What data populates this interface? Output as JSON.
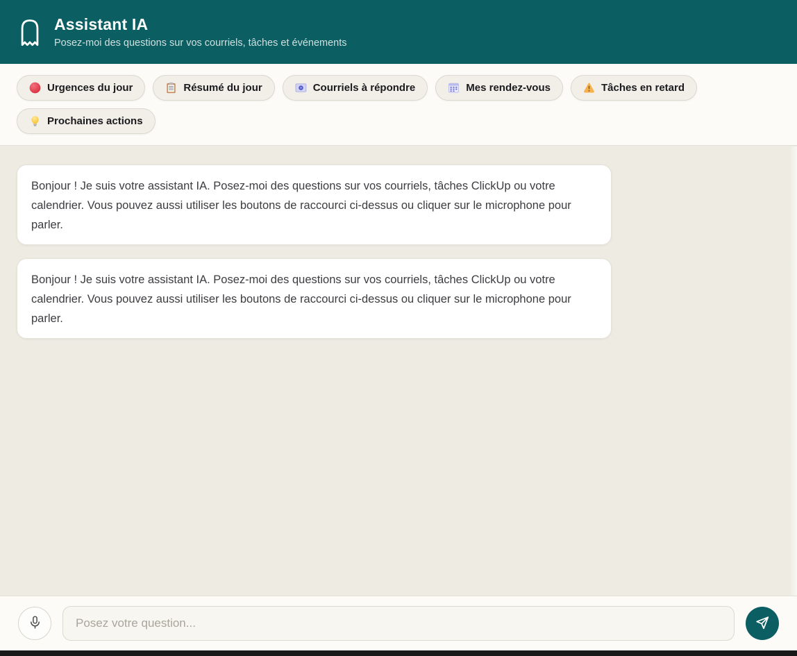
{
  "header": {
    "title": "Assistant IA",
    "subtitle": "Posez-moi des questions sur vos courriels, tâches et événements"
  },
  "quick_actions": [
    {
      "icon": "red-circle-icon",
      "label": "Urgences du jour"
    },
    {
      "icon": "clipboard-icon",
      "label": "Résumé du jour"
    },
    {
      "icon": "email-icon",
      "label": "Courriels à répondre"
    },
    {
      "icon": "calendar-icon",
      "label": "Mes rendez-vous"
    },
    {
      "icon": "warning-icon",
      "label": "Tâches en retard"
    },
    {
      "icon": "lightbulb-icon",
      "label": "Prochaines actions"
    }
  ],
  "messages": [
    {
      "role": "assistant",
      "text": "Bonjour ! Je suis votre assistant IA. Posez-moi des questions sur vos courriels, tâches ClickUp ou votre calendrier. Vous pouvez aussi utiliser les boutons de raccourci ci-dessus ou cliquer sur le microphone pour parler."
    },
    {
      "role": "assistant",
      "text": "Bonjour ! Je suis votre assistant IA. Posez-moi des questions sur vos courriels, tâches ClickUp ou votre calendrier. Vous pouvez aussi utiliser les boutons de raccourci ci-dessus ou cliquer sur le microphone pour parler."
    }
  ],
  "composer": {
    "input_placeholder": "Posez votre question..."
  },
  "colors": {
    "accent_teal": "#0b5e62",
    "urgent_red": "#e04050",
    "warning_amber": "#f7b24e",
    "bulb_yellow": "#fbc833",
    "chat_background": "#edebe2",
    "chip_background": "#f1efe8"
  }
}
